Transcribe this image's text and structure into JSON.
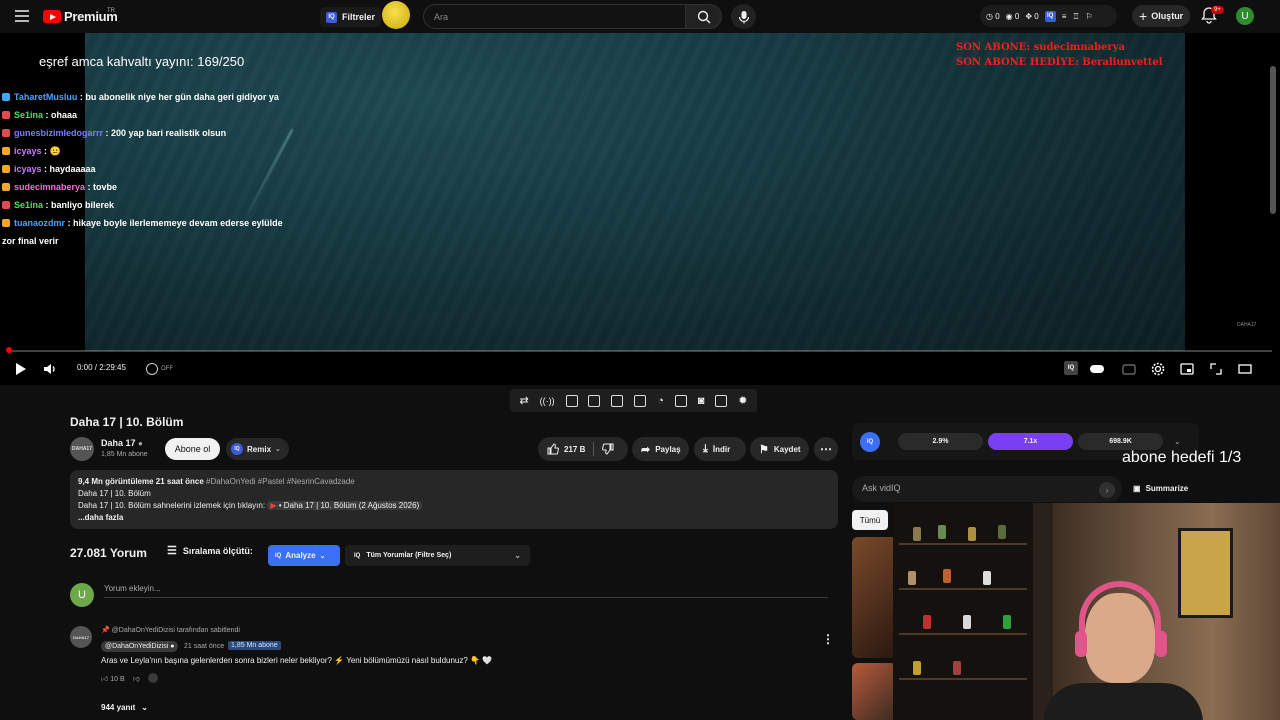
{
  "topbar": {
    "logo_text": "Premium",
    "logo_region": "TR",
    "filters_label": "Filtreler",
    "search_placeholder": "Ara",
    "stats": [
      "0",
      "0",
      "0"
    ],
    "create_label": "Oluştur",
    "notif_count": "9+",
    "user_initial": "U"
  },
  "player": {
    "overlay_title": "eşref amca kahvaltı yayını: 169/250",
    "sub_last": "SON ABONE: sudecimnaberya",
    "sub_gift": "SON ABONE HEDİYE: Beraliunvettel",
    "time": "0:00 / 2:29:45",
    "watermark": "DAHA17",
    "autoplay_off": "OFF",
    "progress": 0,
    "chat": [
      {
        "user": "TaharetMusluu",
        "color": "#4aa3ff",
        "icon": "#3fa9f5",
        "msg": "bu abonelik niye her gün daha geri gidiyor ya"
      },
      {
        "user": "Se1ina",
        "color": "#4ee05b",
        "icon": "#e5484d",
        "msg": "ohaaa"
      },
      {
        "user": "gunesbizimledogarrr",
        "color": "#7b7dff",
        "icon": "#e5484d",
        "msg": "200 yap bari realistik olsun"
      },
      {
        "user": "icyays",
        "color": "#c77dff",
        "icon": "#f5a623",
        "msg": "😐"
      },
      {
        "user": "icyays",
        "color": "#c77dff",
        "icon": "#f5a623",
        "msg": "haydaaaaa"
      },
      {
        "user": "sudecimnaberya",
        "color": "#ff6bd5",
        "icon": "#f5a623",
        "msg": "tovbe"
      },
      {
        "user": "Se1ina",
        "color": "#4ee05b",
        "icon": "#e5484d",
        "msg": "banliyo bilerek"
      },
      {
        "user": "tuanaozdmr",
        "color": "#4aa3ff",
        "icon": "#f5a623",
        "msg": "hikaye boyle ilerlememeye devam ederse eylülde zor final verir"
      }
    ]
  },
  "video": {
    "title": "Daha 17 | 10. Bölüm",
    "channel": "Daha 17",
    "channel_avatar_text": "DAHA17",
    "subscribers": "1,85 Mn abone",
    "subscribe_label": "Abone ol",
    "remix_label": "Remix",
    "likes": "217 B",
    "share_label": "Paylaş",
    "download_label": "İndir",
    "save_label": "Kaydet"
  },
  "description": {
    "meta": "9,4 Mn görüntüleme  21 saat önce",
    "tags": "#DahaOnYedi #Pastel #NesrinCavadzade",
    "line1": "Daha 17 | 10. Bölüm",
    "line2_prefix": "Daha 17 | 10. Bölüm sahnelerini izlemek için tıklayın:",
    "line2_chip": "• Daha 17 | 10. Bölüm (2 Ağustos 2026)",
    "more": "...daha fazla"
  },
  "comments": {
    "count_label": "27.081 Yorum",
    "sort_label": "Sıralama ölçütü:",
    "analyze_label": "Analyze",
    "filter_label": "Tüm Yorumlar (Filtre Seç)",
    "add_placeholder": "Yorum ekleyin...",
    "my_initial": "U",
    "pinned": {
      "pinned_by": "@DahaOnYediDizisi tarafından sabitlendi",
      "author": "@DahaOnYediDizisi",
      "time": "21 saat önce",
      "subs": "1,85 Mn abone",
      "text": "Aras ve Leyla'nın başına gelenlerden sonra bizleri neler bekliyor? ⚡ Yeni bölümümüzü nasıl buldunuz? 👇 🤍",
      "likes": "10 B",
      "replies": "944 yanıt"
    }
  },
  "sidebar": {
    "metrics": [
      {
        "value": "2.9%",
        "bg": "#2a2a2a"
      },
      {
        "value": "7.1x",
        "bg": "#7b3ff2"
      },
      {
        "value": "698.9K",
        "bg": "#2a2a2a"
      }
    ],
    "goal": "abone hedefi 1/3",
    "ask_placeholder": "Ask vidIQ",
    "summarize_label": "Summarize",
    "chip_all": "Tümü"
  },
  "colors": {
    "accent_red": "#ff0000",
    "vidiq_blue": "#3b6ff5",
    "vidiq_purple": "#7b3ff2"
  }
}
